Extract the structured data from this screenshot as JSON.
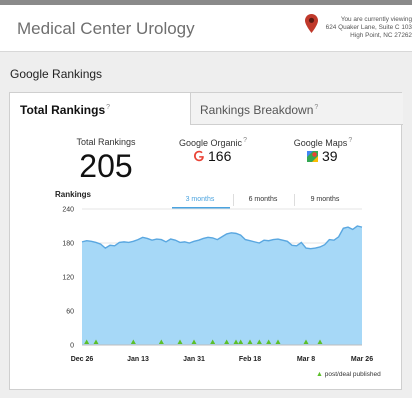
{
  "header": {
    "title": "Medical Center Urology",
    "location_line1": "You are currently viewing",
    "location_line2": "624 Quaker Lane, Suite C 103",
    "location_line3": "High Point, NC 27262"
  },
  "section_title": "Google Rankings",
  "tabs": [
    {
      "label": "Total Rankings",
      "active": true
    },
    {
      "label": "Rankings Breakdown",
      "active": false
    }
  ],
  "help_glyph": "?",
  "stats": {
    "total_label": "Total Rankings",
    "total_value": "205",
    "organic_label": "Google Organic",
    "organic_value": "166",
    "maps_label": "Google Maps",
    "maps_value": "39"
  },
  "chart_controls": {
    "ranges": [
      "3 months",
      "6 months",
      "9 months"
    ],
    "active_range": "3 months"
  },
  "legend_label": "post/deal published",
  "colors": {
    "area_fill": "#a6d8f7",
    "line": "#5aa7e0",
    "marker": "#5cbf2a",
    "accent": "#4aa3df"
  },
  "chart_data": {
    "type": "area",
    "title": "Rankings",
    "ylim": [
      0,
      240
    ],
    "yticks": [
      0,
      60,
      120,
      180,
      240
    ],
    "xtick_labels": [
      "Dec 26",
      "Jan 13",
      "Jan 31",
      "Feb 18",
      "Mar 8",
      "Mar 26"
    ],
    "values": [
      182,
      184,
      183,
      181,
      178,
      171,
      176,
      175,
      181,
      182,
      181,
      183,
      186,
      190,
      188,
      185,
      187,
      186,
      182,
      187,
      185,
      181,
      182,
      180,
      183,
      185,
      188,
      190,
      189,
      186,
      191,
      196,
      198,
      197,
      194,
      186,
      184,
      182,
      180,
      185,
      184,
      186,
      187,
      185,
      183,
      176,
      175,
      181,
      171,
      170,
      171,
      173,
      177,
      186,
      185,
      191,
      206,
      208,
      204,
      210,
      208
    ],
    "post_marker_indices": [
      1,
      3,
      11,
      17,
      21,
      24,
      28,
      31,
      33,
      34,
      36,
      38,
      40,
      42,
      48,
      51
    ]
  }
}
